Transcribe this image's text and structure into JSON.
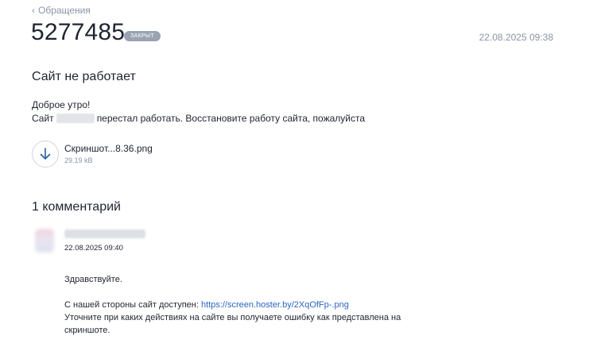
{
  "nav": {
    "back_label": "Обращения"
  },
  "ticket": {
    "id": "5277485",
    "status": "ЗАКРЫТ",
    "datetime": "22.08.2025 09:38",
    "subject": "Сайт не работает",
    "message": {
      "line1": "Доброе утро!",
      "line2_start": "Сайт",
      "line2_end": "перестал работать. Восстановите работу сайта, пожалуйста"
    },
    "attachment": {
      "icon": "download-arrow-icon",
      "name": "Скриншот...8.36.png",
      "size": "29.19 kB"
    }
  },
  "comments": {
    "title": "1 комментарий",
    "items": [
      {
        "datetime": "22.08.2025 09:40",
        "greeting": "Здравствуйте.",
        "text_prefix": "С нашей стороны сайт доступен: ",
        "link": "https://screen.hoster.by/2XqOfFp-.png",
        "text_line2": "Уточните при каких действиях на сайте вы получаете ошибку как представлена на",
        "text_line3": "скриншоте."
      }
    ]
  },
  "colors": {
    "muted": "#8a94a6",
    "badge": "#9aa3b2",
    "link": "#2b66c4",
    "text": "#1f2430"
  }
}
